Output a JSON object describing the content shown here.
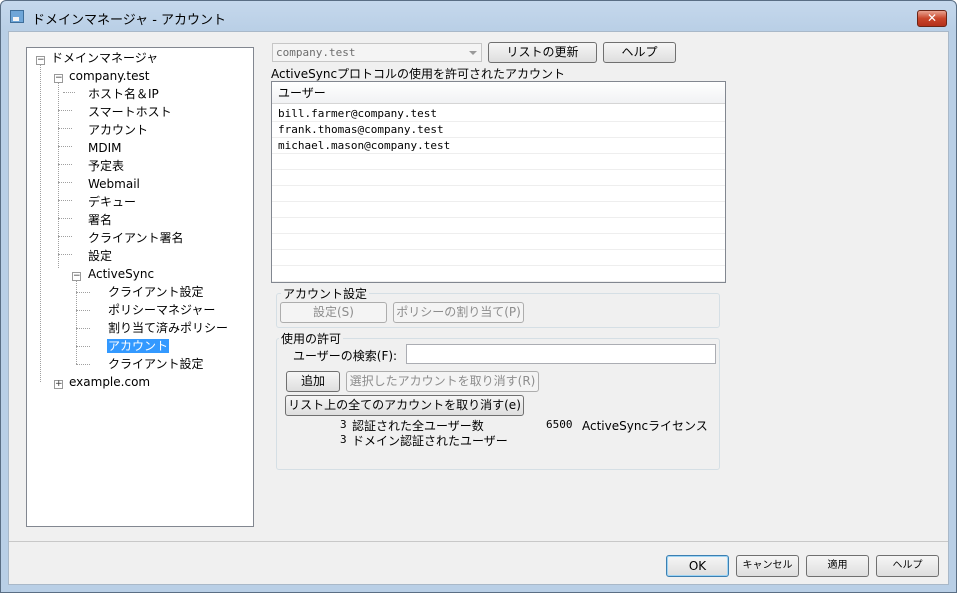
{
  "window": {
    "title": "ドメインマネージャ - アカウント",
    "close_label": "✕"
  },
  "tree": {
    "root": "ドメインマネージャ",
    "domain1": "company.test",
    "items": [
      "ホスト名＆IP",
      "スマートホスト",
      "アカウント",
      "MDIM",
      "予定表",
      "Webmail",
      "デキュー",
      "署名",
      "クライアント署名",
      "設定",
      "ActiveSync"
    ],
    "activesync_children": [
      "クライアント設定",
      "ポリシーマネジャー",
      "割り当て済みポリシー",
      "アカウント",
      "クライアント設定"
    ],
    "domain2": "example.com",
    "expanded_symbol": "−",
    "collapsed_symbol": "+"
  },
  "toolbar": {
    "domain_select": "company.test",
    "refresh_label": "リストの更新",
    "help_label": "ヘルプ"
  },
  "accounts": {
    "heading": "ActiveSyncプロトコルの使用を許可されたアカウント",
    "column_user": "ユーザー",
    "users": [
      "bill.farmer@company.test",
      "frank.thomas@company.test",
      "michael.mason@company.test"
    ]
  },
  "account_settings": {
    "group_label": "アカウント設定",
    "settings_label": "設定(S)",
    "assign_policy_label": "ポリシーの割り当て(P)"
  },
  "permission": {
    "group_label": "使用の許可",
    "search_label": "ユーザーの検索(F):",
    "search_value": "",
    "add_label": "追加",
    "revoke_selected_label": "選択したアカウントを取り消す(R)",
    "revoke_all_label": "リスト上の全てのアカウントを取り消す(e)",
    "stats": {
      "total_users_count": "3",
      "total_users_label": "認証された全ユーザー数",
      "license_count": "6500",
      "license_label": "ActiveSyncライセンス",
      "domain_users_count": "3",
      "domain_users_label": "ドメイン認証されたユーザー"
    }
  },
  "footer": {
    "ok_label": "OK",
    "cancel_label": "キャンセル",
    "apply_label": "適用",
    "help_label": "ヘルプ"
  }
}
